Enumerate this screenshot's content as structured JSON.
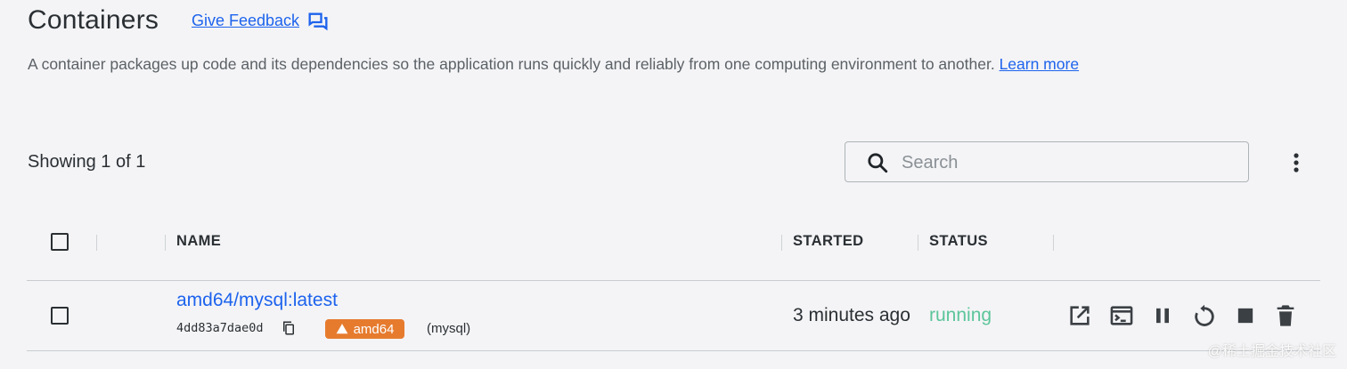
{
  "header": {
    "title": "Containers",
    "feedback_label": "Give Feedback",
    "description": "A container packages up code and its dependencies so the application runs quickly and reliably from one computing environment to another.",
    "learn_more": "Learn more"
  },
  "toolbar": {
    "showing": "Showing 1 of 1",
    "search_placeholder": "Search"
  },
  "table": {
    "columns": {
      "name": "NAME",
      "started": "STARTED",
      "status": "STATUS"
    },
    "rows": [
      {
        "name": "amd64/mysql:latest",
        "id": "4dd83a7dae0d",
        "platform_badge": "amd64",
        "alias": "(mysql)",
        "started": "3 minutes ago",
        "status": "running"
      }
    ]
  },
  "icons": {
    "feedback": "feedback-icon",
    "search": "search-icon",
    "more": "more-vertical-icon",
    "copy": "copy-icon",
    "warning": "warning-icon",
    "open_browser": "open-in-browser-icon",
    "terminal": "terminal-icon",
    "pause": "pause-icon",
    "restart": "restart-icon",
    "stop": "stop-icon",
    "delete": "delete-icon"
  },
  "watermark": "@稀土掘金技术社区",
  "colors": {
    "accent": "#1d63ed",
    "running": "#5cc59a",
    "badge": "#e67b2e",
    "background": "#f4f4f6"
  }
}
